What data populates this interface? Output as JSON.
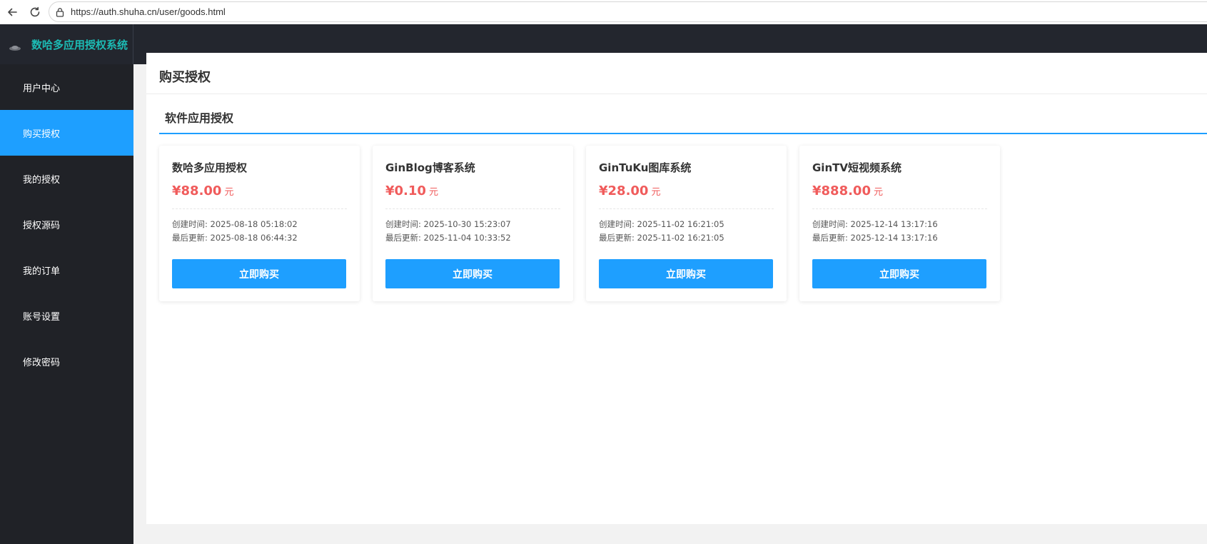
{
  "browser": {
    "url": "https://auth.shuha.cn/user/goods.html",
    "back_icon": "back-arrow-icon",
    "reload_icon": "reload-icon",
    "lock_icon": "lock-icon"
  },
  "app": {
    "brand_title": "数哈多应用授权系统",
    "brand_color": "#1cbbb4"
  },
  "sidebar": {
    "items": [
      {
        "label": "用户中心"
      },
      {
        "label": "购买授权",
        "active": true
      },
      {
        "label": "我的授权"
      },
      {
        "label": "授权源码"
      },
      {
        "label": "我的订单"
      },
      {
        "label": "账号设置"
      },
      {
        "label": "修改密码"
      }
    ],
    "active_color": "#1e9fff"
  },
  "main": {
    "title": "购买授权",
    "section_title": "软件应用授权",
    "cards": [
      {
        "name": "数哈多应用授权",
        "price": "¥88.00",
        "unit": "元",
        "created": "创建时间: 2025-08-18 05:18:02",
        "updated": "最后更新: 2025-08-18 06:44:32",
        "button": "立即购买"
      },
      {
        "name": "GinBlog博客系统",
        "price": "¥0.10",
        "unit": "元",
        "created": "创建时间: 2025-10-30 15:23:07",
        "updated": "最后更新: 2025-11-04 10:33:52",
        "button": "立即购买"
      },
      {
        "name": "GinTuKu图库系统",
        "price": "¥28.00",
        "unit": "元",
        "created": "创建时间: 2025-11-02 16:21:05",
        "updated": "最后更新: 2025-11-02 16:21:05",
        "button": "立即购买"
      },
      {
        "name": "GinTV短视频系统",
        "price": "¥888.00",
        "unit": "元",
        "created": "创建时间: 2025-12-14 13:17:16",
        "updated": "最后更新: 2025-12-14 13:17:16",
        "button": "立即购买"
      }
    ],
    "price_color": "#f05b5b",
    "button_color": "#1e9fff"
  }
}
